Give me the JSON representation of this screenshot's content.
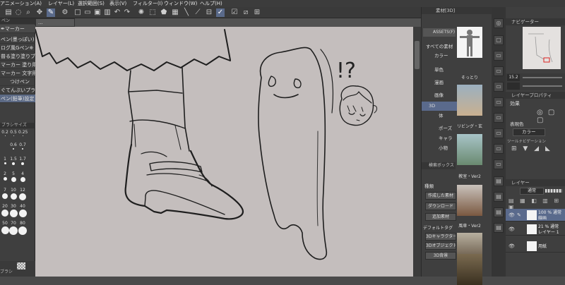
{
  "menubar": {
    "items": [
      "アニメーション(A)",
      "レイヤー(L)",
      "選択範囲(S)",
      "表示(V)",
      "フィルター(I)",
      "ウィンドウ(W)",
      "ヘルプ(H)"
    ]
  },
  "canvas": {
    "tab_label": "..."
  },
  "toolpanel": {
    "header": "ペン",
    "tool_name": "マーカー",
    "sub_tools": [
      "ペン(墨っぽい)",
      "ログ風Gペン※",
      "普る塗り塗りブラシ",
      "マーカー 塗り用",
      "マーカー 文字用",
      "つけペン",
      "ぐてんぷいプラシ",
      "ペン(鉛筆)設定"
    ],
    "brush_size_header": "ブラシサイズ",
    "brush_sizes": [
      "0.2",
      "0.5",
      "0.25",
      "0.6",
      "0.7",
      "1",
      "1.5",
      "1.7",
      "2",
      "5",
      "4",
      "7",
      "10",
      "12",
      "20",
      "30",
      "40",
      "50",
      "70",
      "80"
    ],
    "footer_label": "ブラシ"
  },
  "material_panel": {
    "header": "素材[3D]",
    "assets_label": "ASSETS(F)",
    "tree": [
      "すべての素材",
      "カラー",
      "単色",
      "漫画",
      "画像",
      "3D",
      "体",
      "ポーズ",
      "キャラ",
      "小物"
    ],
    "thumbnails": [
      "そっとり",
      "リビング・玄関",
      "教室・Ver2",
      "風車・Ver2",
      "",
      "教室"
    ],
    "search_header": "検索ボックス",
    "kind_label": "種類",
    "buttons": [
      "作成した素材",
      "ダウンロード",
      "追加素材"
    ],
    "default_tag_label": "デフォルトタグ",
    "tags": [
      "3Dキャラクター",
      "3Dオブジェクト",
      "3D背景"
    ]
  },
  "right_panel": {
    "navigator_header": "ナビゲーター",
    "zoom_value": "15.2",
    "layer_property_header": "レイヤープロパティ",
    "effect_label": "効果",
    "expression_color_label": "表現色",
    "expression_color_value": "カラー",
    "tool_navigation_label": "ツールナビゲーション",
    "layer_header": "レイヤー",
    "blend_mode": "通常",
    "layers": [
      {
        "percent": "100 % 通常",
        "name": "線画"
      },
      {
        "percent": "21 % 通常",
        "name": "レイヤー 1"
      },
      {
        "percent": "",
        "name": "用紙"
      }
    ]
  },
  "sketch": {
    "exclamation": "!?"
  }
}
